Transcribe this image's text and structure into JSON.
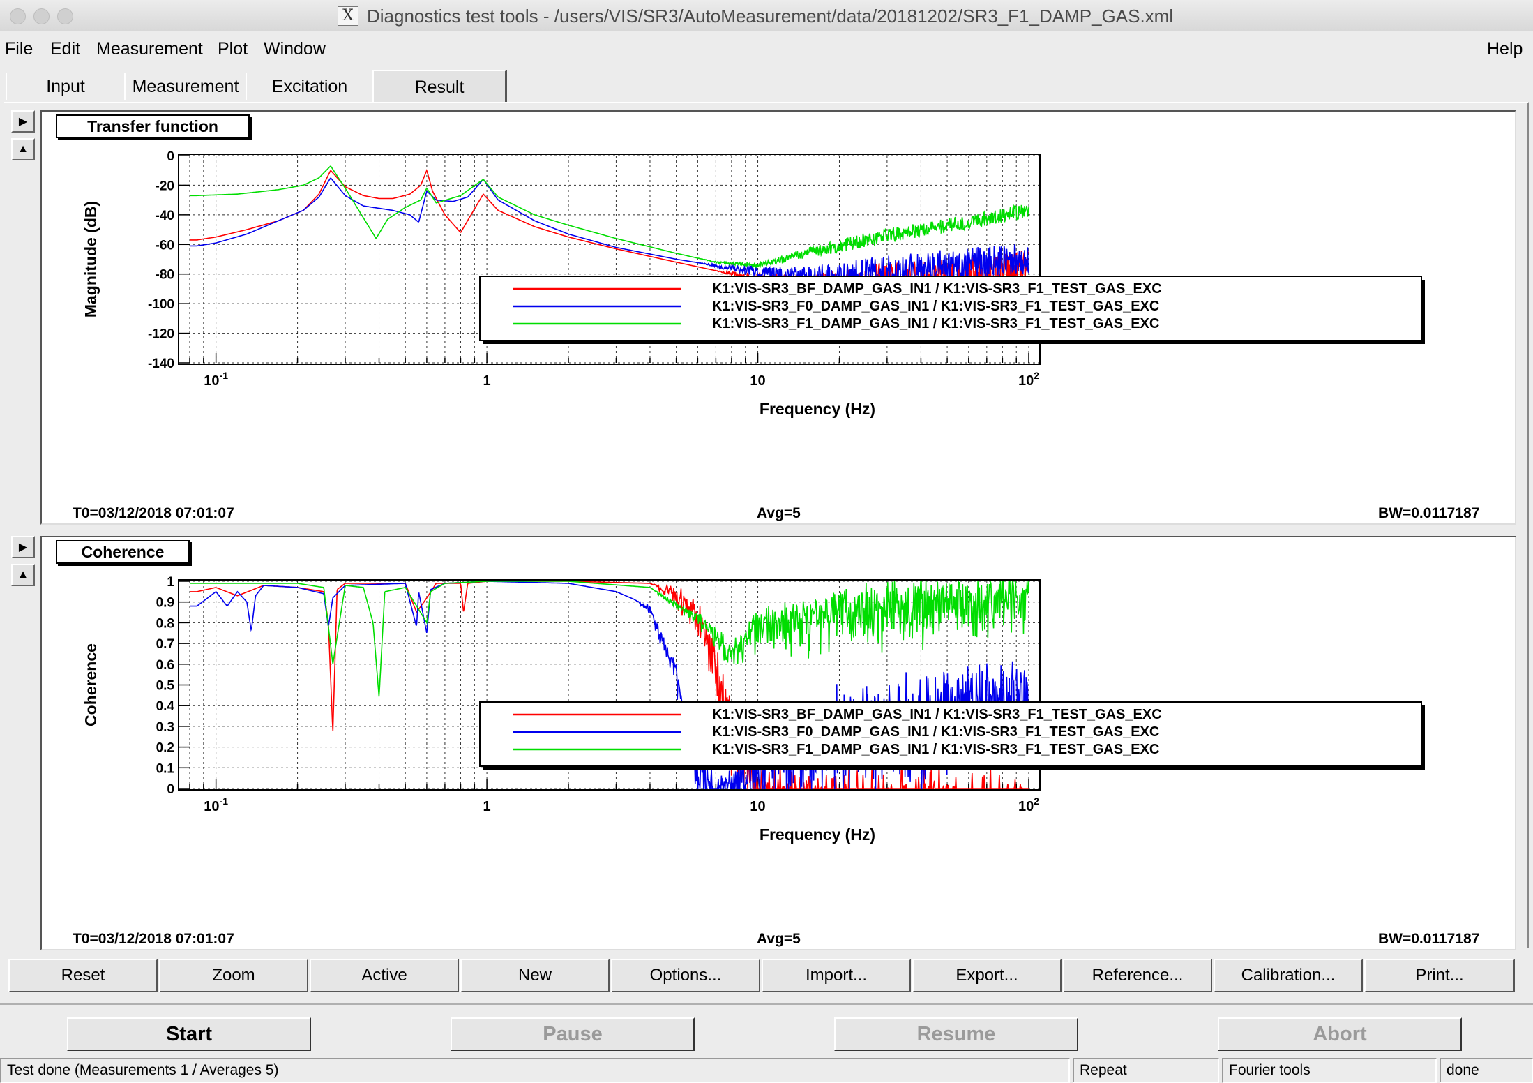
{
  "window": {
    "title": "Diagnostics test tools - /users/VIS/SR3/AutoMeasurement/data/20181202/SR3_F1_DAMP_GAS.xml"
  },
  "menu": {
    "file": "File",
    "edit": "Edit",
    "measurement": "Measurement",
    "plot": "Plot",
    "window": "Window",
    "help": "Help"
  },
  "tabs": {
    "input": "Input",
    "measurement": "Measurement",
    "excitation": "Excitation",
    "result": "Result",
    "active": "Result"
  },
  "colors": {
    "red": "#ff0000",
    "blue": "#0000ee",
    "green": "#00dd00"
  },
  "panels": [
    {
      "title": "Transfer function",
      "t0": "T0=03/12/2018 07:01:07",
      "avg": "Avg=5",
      "bw": "BW=0.0117187"
    },
    {
      "title": "Coherence",
      "t0": "T0=03/12/2018 07:01:07",
      "avg": "Avg=5",
      "bw": "BW=0.0117187"
    }
  ],
  "chart_data": [
    {
      "type": "line",
      "ylabel": "Magnitude (dB)",
      "xlabel": "Frequency (Hz)",
      "xscale": "log",
      "xlim": [
        0.08,
        100
      ],
      "ylim": [
        -140,
        0
      ],
      "grid": true,
      "yticks": [
        "0",
        "-20",
        "-40",
        "-60",
        "-80",
        "-100",
        "-120",
        "-140"
      ],
      "yticks_values": [
        0,
        -20,
        -40,
        -60,
        -80,
        -100,
        -120,
        -140
      ],
      "xticks": [
        {
          "base": "10",
          "exp": "-1",
          "value": 0.1
        },
        {
          "base": "1",
          "exp": "",
          "value": 1
        },
        {
          "base": "10",
          "exp": "",
          "value": 10
        },
        {
          "base": "10",
          "exp": "2",
          "value": 100
        }
      ],
      "legend_position": "bottom-right",
      "series": [
        {
          "name": "K1:VIS-SR3_BF_DAMP_GAS_IN1 / K1:VIS-SR3_F1_TEST_GAS_EXC",
          "color": "#ff0000",
          "x": [
            0.085,
            0.1,
            0.13,
            0.17,
            0.21,
            0.24,
            0.265,
            0.3,
            0.35,
            0.4,
            0.45,
            0.52,
            0.57,
            0.6,
            0.63,
            0.7,
            0.8,
            0.9,
            0.97,
            1.1,
            1.5,
            2,
            3,
            5,
            8,
            12,
            20,
            40,
            60,
            100
          ],
          "y": [
            -57,
            -55,
            -50,
            -44,
            -37,
            -26,
            -10,
            -21,
            -27,
            -29,
            -29,
            -26,
            -20,
            -10,
            -24,
            -40,
            -52,
            -36,
            -26,
            -37,
            -48,
            -55,
            -63,
            -72,
            -80,
            -85,
            -88,
            -86,
            -83,
            -78
          ],
          "noise_from": 7,
          "noise_amp": 15
        },
        {
          "name": "K1:VIS-SR3_F0_DAMP_GAS_IN1 / K1:VIS-SR3_F1_TEST_GAS_EXC",
          "color": "#0000ee",
          "x": [
            0.085,
            0.1,
            0.13,
            0.17,
            0.21,
            0.24,
            0.265,
            0.3,
            0.35,
            0.45,
            0.52,
            0.56,
            0.6,
            0.65,
            0.75,
            0.85,
            0.97,
            1.1,
            1.5,
            2,
            3,
            5,
            8,
            12,
            20,
            40,
            100
          ],
          "y": [
            -61,
            -59,
            -53,
            -44,
            -37,
            -28,
            -15,
            -27,
            -34,
            -37,
            -40,
            -45,
            -24,
            -30,
            -31,
            -28,
            -16,
            -30,
            -44,
            -53,
            -62,
            -70,
            -76,
            -80,
            -82,
            -76,
            -70
          ],
          "noise_from": 6,
          "noise_amp": 11
        },
        {
          "name": "K1:VIS-SR3_F1_DAMP_GAS_IN1 / K1:VIS-SR3_F1_TEST_GAS_EXC",
          "color": "#00dd00",
          "x": [
            0.085,
            0.12,
            0.17,
            0.21,
            0.24,
            0.265,
            0.3,
            0.35,
            0.39,
            0.43,
            0.5,
            0.57,
            0.6,
            0.65,
            0.8,
            0.97,
            1.1,
            1.5,
            2,
            3,
            5,
            7,
            10,
            15,
            30,
            60,
            100
          ],
          "y": [
            -27,
            -26,
            -23,
            -20,
            -15,
            -7,
            -22,
            -42,
            -56,
            -43,
            -35,
            -30,
            -22,
            -32,
            -27,
            -16,
            -28,
            -40,
            -47,
            -56,
            -66,
            -72,
            -74,
            -66,
            -54,
            -45,
            -37
          ],
          "noise_from": 6,
          "noise_amp": 5
        }
      ]
    },
    {
      "type": "line",
      "ylabel": "Coherence",
      "xlabel": "Frequency (Hz)",
      "xscale": "log",
      "xlim": [
        0.08,
        100
      ],
      "ylim": [
        0,
        1
      ],
      "grid": true,
      "yticks": [
        "1",
        "0.9",
        "0.8",
        "0.7",
        "0.6",
        "0.5",
        "0.4",
        "0.3",
        "0.2",
        "0.1",
        "0"
      ],
      "yticks_values": [
        1,
        0.9,
        0.8,
        0.7,
        0.6,
        0.5,
        0.4,
        0.3,
        0.2,
        0.1,
        0
      ],
      "xticks": [
        {
          "base": "10",
          "exp": "-1",
          "value": 0.1
        },
        {
          "base": "1",
          "exp": "",
          "value": 1
        },
        {
          "base": "10",
          "exp": "",
          "value": 10
        },
        {
          "base": "10",
          "exp": "2",
          "value": 100
        }
      ],
      "legend_position": "bottom-right",
      "series": [
        {
          "name": "K1:VIS-SR3_BF_DAMP_GAS_IN1 / K1:VIS-SR3_F1_TEST_GAS_EXC",
          "color": "#ff0000",
          "x": [
            0.085,
            0.1,
            0.12,
            0.15,
            0.2,
            0.25,
            0.26,
            0.27,
            0.28,
            0.3,
            0.5,
            0.55,
            0.6,
            0.65,
            0.8,
            0.82,
            0.85,
            1,
            2,
            4,
            5,
            6,
            7,
            8,
            10,
            20,
            50,
            100
          ],
          "y": [
            0.95,
            0.97,
            0.93,
            0.98,
            0.97,
            0.95,
            0.8,
            0.27,
            0.96,
            0.99,
            0.99,
            0.85,
            0.92,
            0.99,
            0.99,
            0.85,
            0.99,
            1.0,
            1.0,
            0.99,
            0.97,
            0.9,
            0.7,
            0.4,
            0.1,
            0.05,
            0.05,
            0.05
          ],
          "noise_from": 4,
          "noise_amp": 0.6
        },
        {
          "name": "K1:VIS-SR3_F0_DAMP_GAS_IN1 / K1:VIS-SR3_F1_TEST_GAS_EXC",
          "color": "#0000ee",
          "x": [
            0.085,
            0.1,
            0.11,
            0.12,
            0.13,
            0.135,
            0.14,
            0.15,
            0.2,
            0.25,
            0.26,
            0.27,
            0.3,
            0.5,
            0.55,
            0.56,
            0.6,
            0.62,
            0.7,
            1,
            2,
            3,
            4,
            5,
            5.5,
            6,
            7,
            9,
            12,
            20,
            50,
            100
          ],
          "y": [
            0.88,
            0.95,
            0.88,
            0.95,
            0.9,
            0.76,
            0.93,
            0.98,
            0.97,
            0.94,
            0.78,
            0.92,
            0.98,
            0.99,
            0.78,
            0.95,
            0.75,
            0.96,
            0.99,
            1.0,
            0.99,
            0.95,
            0.88,
            0.6,
            0.3,
            0.15,
            0.05,
            0.15,
            0.35,
            0.45,
            0.55,
            0.6
          ],
          "noise_from": 3.5,
          "noise_amp": 0.45
        },
        {
          "name": "K1:VIS-SR3_F1_DAMP_GAS_IN1 / K1:VIS-SR3_F1_TEST_GAS_EXC",
          "color": "#00dd00",
          "x": [
            0.085,
            0.2,
            0.25,
            0.27,
            0.3,
            0.35,
            0.38,
            0.4,
            0.42,
            0.5,
            0.6,
            0.62,
            0.7,
            1,
            2,
            4,
            5,
            6,
            8,
            10,
            20,
            50,
            100
          ],
          "y": [
            0.99,
            0.99,
            0.97,
            0.6,
            0.98,
            0.97,
            0.8,
            0.44,
            0.95,
            0.97,
            0.8,
            0.95,
            0.99,
            1.0,
            1.0,
            0.97,
            0.9,
            0.85,
            0.7,
            0.85,
            0.95,
            0.99,
            1.0
          ],
          "noise_from": 4,
          "noise_amp": 0.25
        }
      ]
    }
  ],
  "toolbar": [
    "Reset",
    "Zoom",
    "Active",
    "New",
    "Options...",
    "Import...",
    "Export...",
    "Reference...",
    "Calibration...",
    "Print..."
  ],
  "controls": {
    "start": "Start",
    "pause": "Pause",
    "resume": "Resume",
    "abort": "Abort"
  },
  "status": {
    "message": "Test done (Measurements 1 / Averages 5)",
    "repeat": "Repeat",
    "fourier": "Fourier tools",
    "state": "done"
  },
  "icons": {
    "expand": "triangle-right-icon",
    "collapse": "triangle-up-icon",
    "app": "x11-icon"
  }
}
